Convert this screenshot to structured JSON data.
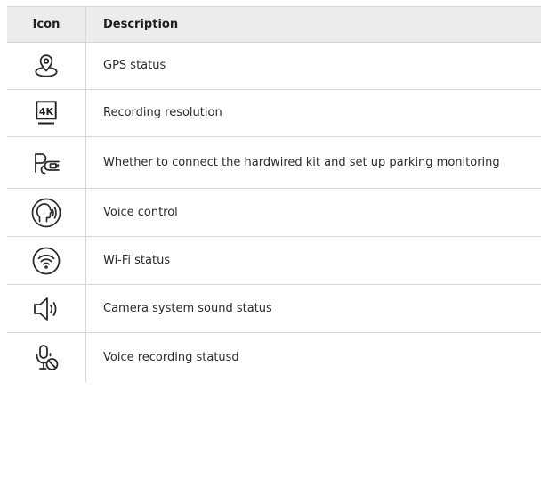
{
  "table": {
    "headers": {
      "icon": "Icon",
      "description": "Description"
    },
    "rows": [
      {
        "icon": "gps-location-pin-icon",
        "description": "GPS status"
      },
      {
        "icon": "4k-resolution-icon",
        "description": "Recording resolution",
        "icon_text": "4K"
      },
      {
        "icon": "parking-plug-icon",
        "description": "Whether to connect the hardwired kit and set up parking monitoring"
      },
      {
        "icon": "voice-control-icon",
        "description": "Voice control"
      },
      {
        "icon": "wifi-icon",
        "description": "Wi-Fi status"
      },
      {
        "icon": "speaker-icon",
        "description": "Camera system sound status"
      },
      {
        "icon": "microphone-muted-icon",
        "description": "Voice recording statusd"
      }
    ]
  }
}
